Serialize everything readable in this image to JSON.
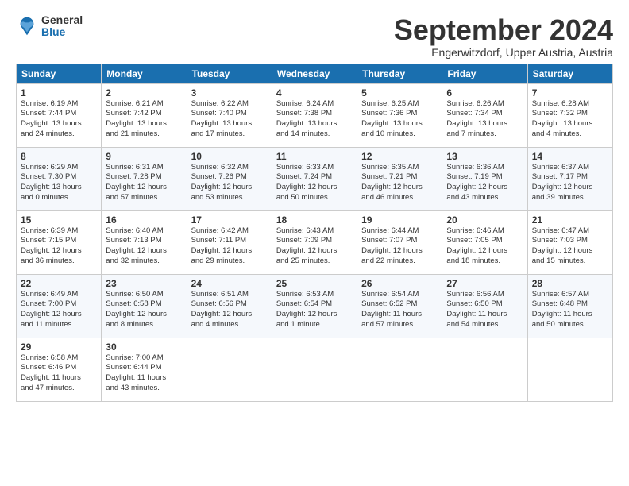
{
  "logo": {
    "general": "General",
    "blue": "Blue"
  },
  "title": "September 2024",
  "subtitle": "Engerwitzdorf, Upper Austria, Austria",
  "headers": [
    "Sunday",
    "Monday",
    "Tuesday",
    "Wednesday",
    "Thursday",
    "Friday",
    "Saturday"
  ],
  "weeks": [
    [
      {
        "day": "1",
        "lines": [
          "Sunrise: 6:19 AM",
          "Sunset: 7:44 PM",
          "Daylight: 13 hours",
          "and 24 minutes."
        ]
      },
      {
        "day": "2",
        "lines": [
          "Sunrise: 6:21 AM",
          "Sunset: 7:42 PM",
          "Daylight: 13 hours",
          "and 21 minutes."
        ]
      },
      {
        "day": "3",
        "lines": [
          "Sunrise: 6:22 AM",
          "Sunset: 7:40 PM",
          "Daylight: 13 hours",
          "and 17 minutes."
        ]
      },
      {
        "day": "4",
        "lines": [
          "Sunrise: 6:24 AM",
          "Sunset: 7:38 PM",
          "Daylight: 13 hours",
          "and 14 minutes."
        ]
      },
      {
        "day": "5",
        "lines": [
          "Sunrise: 6:25 AM",
          "Sunset: 7:36 PM",
          "Daylight: 13 hours",
          "and 10 minutes."
        ]
      },
      {
        "day": "6",
        "lines": [
          "Sunrise: 6:26 AM",
          "Sunset: 7:34 PM",
          "Daylight: 13 hours",
          "and 7 minutes."
        ]
      },
      {
        "day": "7",
        "lines": [
          "Sunrise: 6:28 AM",
          "Sunset: 7:32 PM",
          "Daylight: 13 hours",
          "and 4 minutes."
        ]
      }
    ],
    [
      {
        "day": "8",
        "lines": [
          "Sunrise: 6:29 AM",
          "Sunset: 7:30 PM",
          "Daylight: 13 hours",
          "and 0 minutes."
        ]
      },
      {
        "day": "9",
        "lines": [
          "Sunrise: 6:31 AM",
          "Sunset: 7:28 PM",
          "Daylight: 12 hours",
          "and 57 minutes."
        ]
      },
      {
        "day": "10",
        "lines": [
          "Sunrise: 6:32 AM",
          "Sunset: 7:26 PM",
          "Daylight: 12 hours",
          "and 53 minutes."
        ]
      },
      {
        "day": "11",
        "lines": [
          "Sunrise: 6:33 AM",
          "Sunset: 7:24 PM",
          "Daylight: 12 hours",
          "and 50 minutes."
        ]
      },
      {
        "day": "12",
        "lines": [
          "Sunrise: 6:35 AM",
          "Sunset: 7:21 PM",
          "Daylight: 12 hours",
          "and 46 minutes."
        ]
      },
      {
        "day": "13",
        "lines": [
          "Sunrise: 6:36 AM",
          "Sunset: 7:19 PM",
          "Daylight: 12 hours",
          "and 43 minutes."
        ]
      },
      {
        "day": "14",
        "lines": [
          "Sunrise: 6:37 AM",
          "Sunset: 7:17 PM",
          "Daylight: 12 hours",
          "and 39 minutes."
        ]
      }
    ],
    [
      {
        "day": "15",
        "lines": [
          "Sunrise: 6:39 AM",
          "Sunset: 7:15 PM",
          "Daylight: 12 hours",
          "and 36 minutes."
        ]
      },
      {
        "day": "16",
        "lines": [
          "Sunrise: 6:40 AM",
          "Sunset: 7:13 PM",
          "Daylight: 12 hours",
          "and 32 minutes."
        ]
      },
      {
        "day": "17",
        "lines": [
          "Sunrise: 6:42 AM",
          "Sunset: 7:11 PM",
          "Daylight: 12 hours",
          "and 29 minutes."
        ]
      },
      {
        "day": "18",
        "lines": [
          "Sunrise: 6:43 AM",
          "Sunset: 7:09 PM",
          "Daylight: 12 hours",
          "and 25 minutes."
        ]
      },
      {
        "day": "19",
        "lines": [
          "Sunrise: 6:44 AM",
          "Sunset: 7:07 PM",
          "Daylight: 12 hours",
          "and 22 minutes."
        ]
      },
      {
        "day": "20",
        "lines": [
          "Sunrise: 6:46 AM",
          "Sunset: 7:05 PM",
          "Daylight: 12 hours",
          "and 18 minutes."
        ]
      },
      {
        "day": "21",
        "lines": [
          "Sunrise: 6:47 AM",
          "Sunset: 7:03 PM",
          "Daylight: 12 hours",
          "and 15 minutes."
        ]
      }
    ],
    [
      {
        "day": "22",
        "lines": [
          "Sunrise: 6:49 AM",
          "Sunset: 7:00 PM",
          "Daylight: 12 hours",
          "and 11 minutes."
        ]
      },
      {
        "day": "23",
        "lines": [
          "Sunrise: 6:50 AM",
          "Sunset: 6:58 PM",
          "Daylight: 12 hours",
          "and 8 minutes."
        ]
      },
      {
        "day": "24",
        "lines": [
          "Sunrise: 6:51 AM",
          "Sunset: 6:56 PM",
          "Daylight: 12 hours",
          "and 4 minutes."
        ]
      },
      {
        "day": "25",
        "lines": [
          "Sunrise: 6:53 AM",
          "Sunset: 6:54 PM",
          "Daylight: 12 hours",
          "and 1 minute."
        ]
      },
      {
        "day": "26",
        "lines": [
          "Sunrise: 6:54 AM",
          "Sunset: 6:52 PM",
          "Daylight: 11 hours",
          "and 57 minutes."
        ]
      },
      {
        "day": "27",
        "lines": [
          "Sunrise: 6:56 AM",
          "Sunset: 6:50 PM",
          "Daylight: 11 hours",
          "and 54 minutes."
        ]
      },
      {
        "day": "28",
        "lines": [
          "Sunrise: 6:57 AM",
          "Sunset: 6:48 PM",
          "Daylight: 11 hours",
          "and 50 minutes."
        ]
      }
    ],
    [
      {
        "day": "29",
        "lines": [
          "Sunrise: 6:58 AM",
          "Sunset: 6:46 PM",
          "Daylight: 11 hours",
          "and 47 minutes."
        ]
      },
      {
        "day": "30",
        "lines": [
          "Sunrise: 7:00 AM",
          "Sunset: 6:44 PM",
          "Daylight: 11 hours",
          "and 43 minutes."
        ]
      },
      {
        "day": "",
        "lines": []
      },
      {
        "day": "",
        "lines": []
      },
      {
        "day": "",
        "lines": []
      },
      {
        "day": "",
        "lines": []
      },
      {
        "day": "",
        "lines": []
      }
    ]
  ]
}
